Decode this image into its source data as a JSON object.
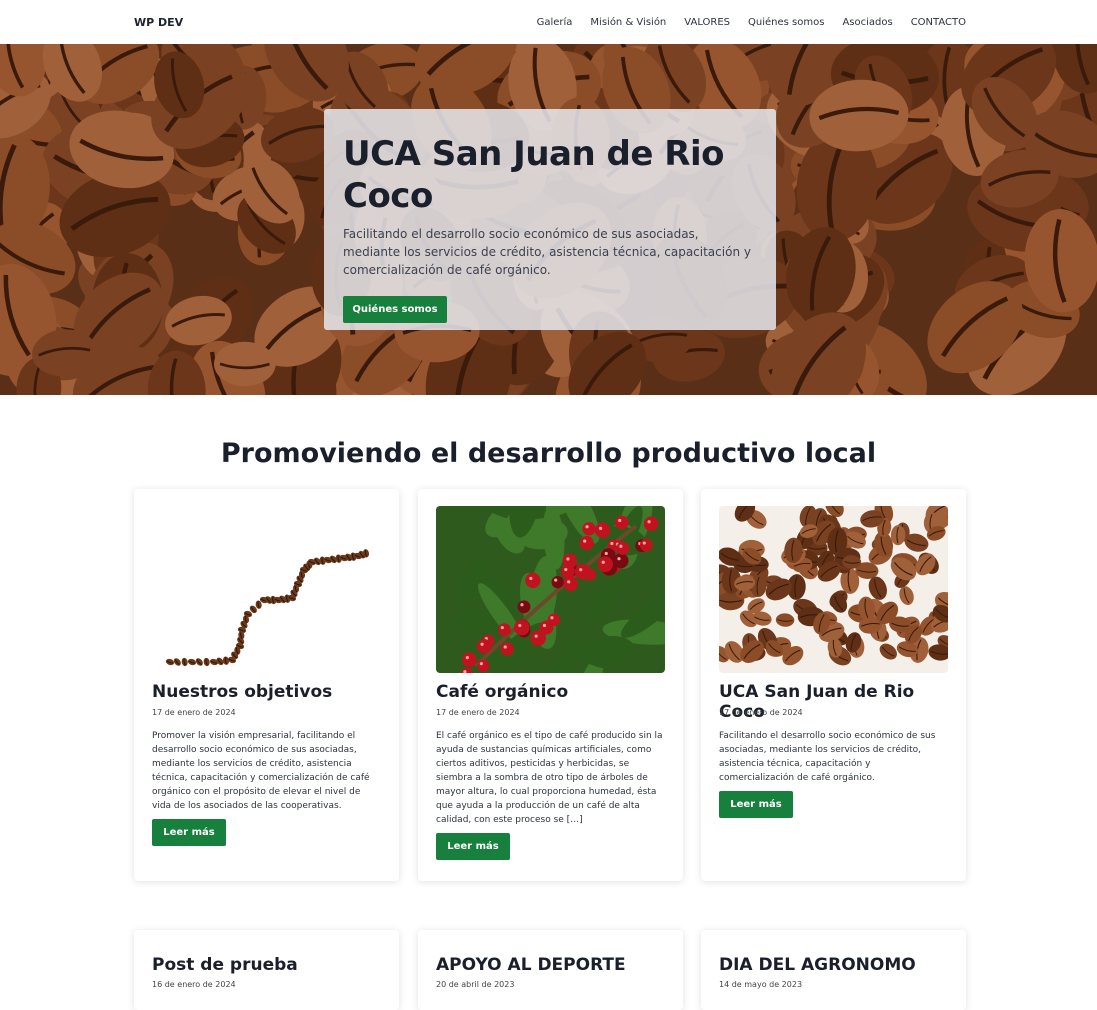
{
  "nav": {
    "brand": "WP DEV",
    "items": [
      "Galería",
      "Misión & Visión",
      "VALORES",
      "Quiénes somos",
      "Asociados",
      "CONTACTO"
    ]
  },
  "hero": {
    "title": "UCA San Juan de Rio Coco",
    "subtitle": "Facilitando el desarrollo socio económico de sus asociadas, mediante los servicios de crédito, asistencia técnica, capacitación y comercialización de café orgánico.",
    "button": "Quiénes somos"
  },
  "section": {
    "title": "Promoviendo el desarrollo productivo local"
  },
  "cards": [
    {
      "title": "Nuestros objetivos",
      "date": "17 de enero de 2024",
      "text": "Promover la visión empresarial, facilitando el desarrollo socio económico de sus asociadas, mediante los servicios de crédito, asistencia técnica, capacitación y comercialización de café orgánico con el propósito de elevar el nivel de vida de los asociados de las cooperativas.",
      "button": "Leer más"
    },
    {
      "title": "Café orgánico",
      "date": "17 de enero de 2024",
      "text": "El café orgánico es el tipo de café producido sin la ayuda de sustancias químicas artificiales, como ciertos aditivos, pesticidas y herbicidas, se siembra a la sombra de otro tipo de árboles de mayor altura, lo cual proporciona humedad, ésta que ayuda a la producción de un café de alta calidad, con este proceso se […]",
      "button": "Leer más"
    },
    {
      "title": "UCA San Juan de Rio Coco",
      "date": "17 de enero de 2024",
      "text": "Facilitando el desarrollo socio económico de sus asociadas, mediante los servicios de crédito, asistencia técnica, capacitación y comercialización de café orgánico.",
      "button": "Leer más"
    }
  ],
  "posts": [
    {
      "title": "Post de prueba",
      "date": "16 de enero de 2024"
    },
    {
      "title": "APOYO AL DEPORTE",
      "date": "20 de abril de 2023"
    },
    {
      "title": "DIA DEL AGRONOMO",
      "date": "14 de mayo de 2023"
    }
  ]
}
